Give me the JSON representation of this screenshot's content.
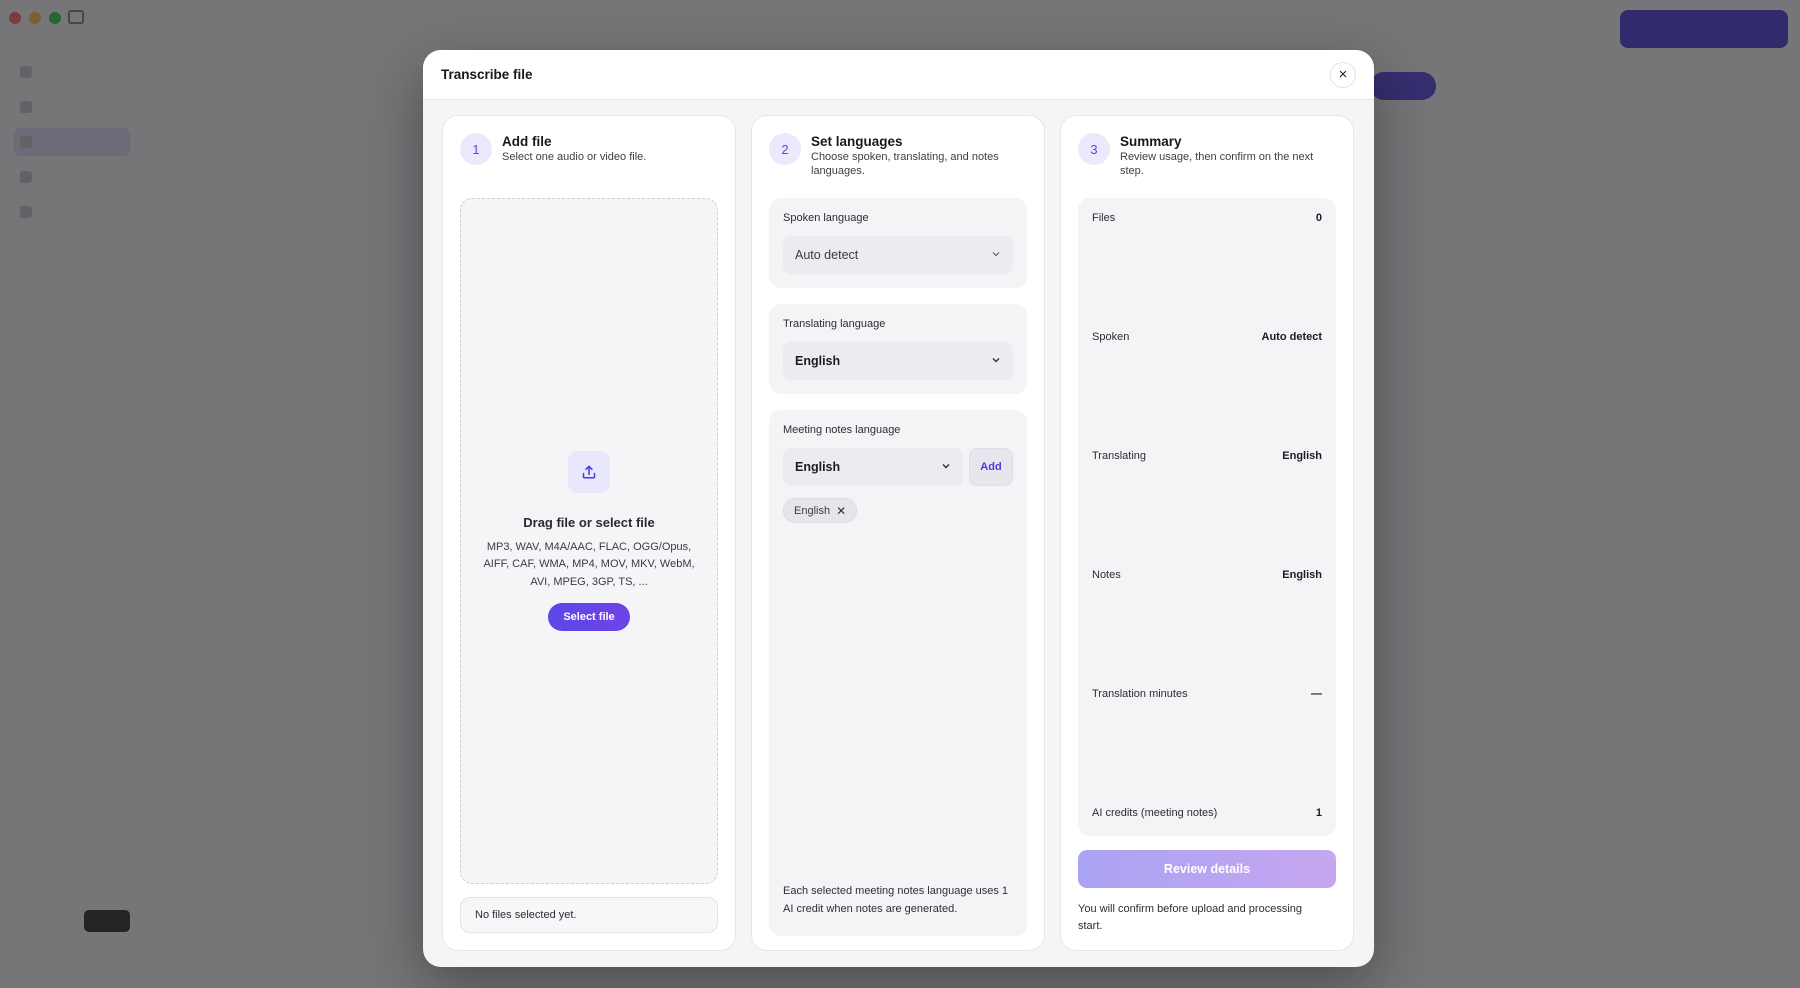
{
  "modal": {
    "title": "Transcribe file",
    "close_icon": "×"
  },
  "steps": [
    {
      "number": "1",
      "title": "Add file",
      "subtitle": "Select one audio or video file."
    },
    {
      "number": "2",
      "title": "Set languages",
      "subtitle": "Choose spoken, translating, and notes languages."
    },
    {
      "number": "3",
      "title": "Summary",
      "subtitle": "Review usage, then confirm on the next step."
    }
  ],
  "add_file": {
    "upload_icon": "upload-icon",
    "drop_title": "Drag file or select file",
    "formats": "MP3, WAV, M4A/AAC, FLAC, OGG/Opus, AIFF, CAF, WMA, MP4, MOV, MKV, WebM, AVI, MPEG, 3GP, TS, ...",
    "select_button": "Select file",
    "status": "No files selected yet."
  },
  "languages": {
    "spoken": {
      "label": "Spoken language",
      "value": "Auto detect"
    },
    "translating": {
      "label": "Translating language",
      "value": "English"
    },
    "notes": {
      "label": "Meeting notes language",
      "value": "English",
      "add_button": "Add",
      "chips": [
        "English"
      ],
      "chip_remove": "✕"
    },
    "footer": "Each selected meeting notes language uses 1 AI credit when notes are generated."
  },
  "summary": {
    "rows": [
      {
        "label": "Files",
        "value": "0"
      },
      {
        "label": "Spoken",
        "value": "Auto detect"
      },
      {
        "label": "Translating",
        "value": "English"
      },
      {
        "label": "Notes",
        "value": "English"
      },
      {
        "label": "Translation minutes",
        "value": "—"
      },
      {
        "label": "AI credits (meeting notes)",
        "value": "1"
      }
    ],
    "review_button": "Review details",
    "note": "You will confirm before upload and processing start."
  },
  "colors": {
    "accent": "#5b47ea",
    "accent_light": "#ebe9fb",
    "disabled_button_start": "#aaa3f3",
    "disabled_button_end": "#c6a6f0"
  }
}
